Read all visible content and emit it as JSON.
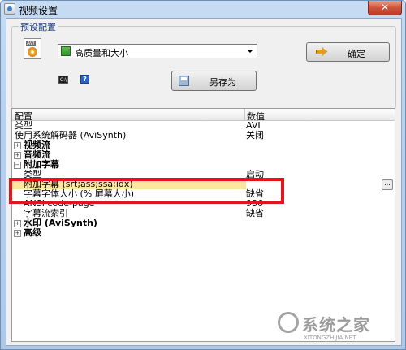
{
  "window": {
    "title": "视频设置",
    "close_glyph": "✕"
  },
  "preset": {
    "group_label": "预设配置",
    "file_icon_tag": "AVI",
    "selected_preset": "高质量和大小",
    "ok_label": "确定",
    "save_as_label": "另存为",
    "cmd_icon_text": "C:\\",
    "help_icon_text": "?"
  },
  "grid": {
    "columns": [
      "配置",
      "数值"
    ],
    "rows": [
      {
        "name": "类型",
        "value": "AVI"
      },
      {
        "name": "使用系统解码器 (AviSynth)",
        "value": "关闭"
      },
      {
        "name": "视频流",
        "expander": "+",
        "value": ""
      },
      {
        "name": "音频流",
        "expander": "+",
        "value": ""
      },
      {
        "name": "附加字幕",
        "expander": "−",
        "value": ""
      },
      {
        "name": "类型",
        "value": "启动"
      },
      {
        "name": "附加字幕 (srt;ass;ssa;idx)",
        "value": "",
        "button": "..."
      },
      {
        "name": "字幕字体大小 (% 屏幕大小)",
        "value": "缺省"
      },
      {
        "name": "ANSI code-page",
        "value": "936"
      },
      {
        "name": "字幕流索引",
        "value": "缺省"
      },
      {
        "name": "水印 (AviSynth)",
        "expander": "+",
        "value": ""
      },
      {
        "name": "高级",
        "expander": "+",
        "value": ""
      }
    ]
  },
  "watermark": {
    "text": "系统之家",
    "url": "XITONGZHIJIA.NET"
  }
}
